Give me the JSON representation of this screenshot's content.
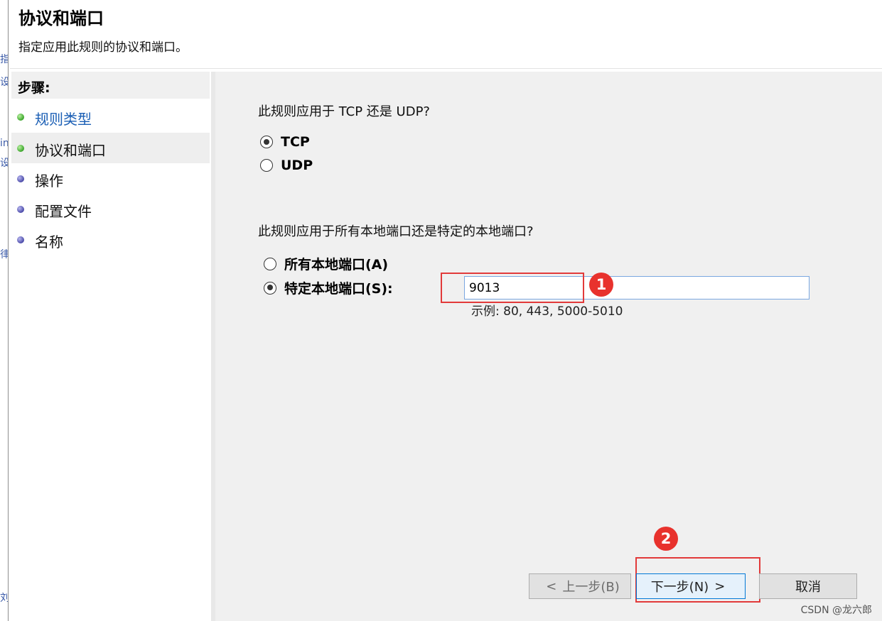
{
  "header": {
    "title": "协议和端口",
    "subtitle": "指定应用此规则的协议和端口。"
  },
  "edge_fragment": {
    "glyphs": [
      "指",
      "设",
      "in",
      "设",
      "律",
      "刘"
    ]
  },
  "steps": {
    "heading": "步骤:",
    "items": [
      {
        "label": "规则类型",
        "dot": "green",
        "style": "link"
      },
      {
        "label": "协议和端口",
        "dot": "green",
        "style": "active"
      },
      {
        "label": "操作",
        "dot": "purple",
        "style": "normal"
      },
      {
        "label": "配置文件",
        "dot": "purple",
        "style": "normal"
      },
      {
        "label": "名称",
        "dot": "purple",
        "style": "normal"
      }
    ]
  },
  "protocol": {
    "question": "此规则应用于 TCP 还是 UDP?",
    "options": [
      {
        "label": "TCP",
        "checked": true
      },
      {
        "label": "UDP",
        "checked": false
      }
    ]
  },
  "ports": {
    "question": "此规则应用于所有本地端口还是特定的本地端口?",
    "options": [
      {
        "label": "所有本地端口(A)",
        "checked": false
      },
      {
        "label": "特定本地端口(S):",
        "checked": true
      }
    ],
    "input_value": "9013",
    "example": "示例: 80, 443, 5000-5010"
  },
  "annotations": {
    "marker_1": "1",
    "marker_2": "2",
    "color": "#e23a3a"
  },
  "buttons": {
    "back": {
      "chevron": "<",
      "label": "上一步(B)"
    },
    "next": {
      "label": "下一步(N)",
      "chevron": ">"
    },
    "cancel": {
      "label": "取消"
    }
  },
  "watermark": "CSDN @龙六郎",
  "colors": {
    "content_bg": "#f0f0f0",
    "link": "#1b5fb5",
    "step_done": "#3aa52a",
    "step_pending": "#4a4aa8",
    "next_border": "#0078d7"
  },
  "icons": [
    "radio-checked-icon",
    "radio-unchecked-icon",
    "step-dot-icon",
    "chevron-left-icon",
    "chevron-right-icon"
  ]
}
